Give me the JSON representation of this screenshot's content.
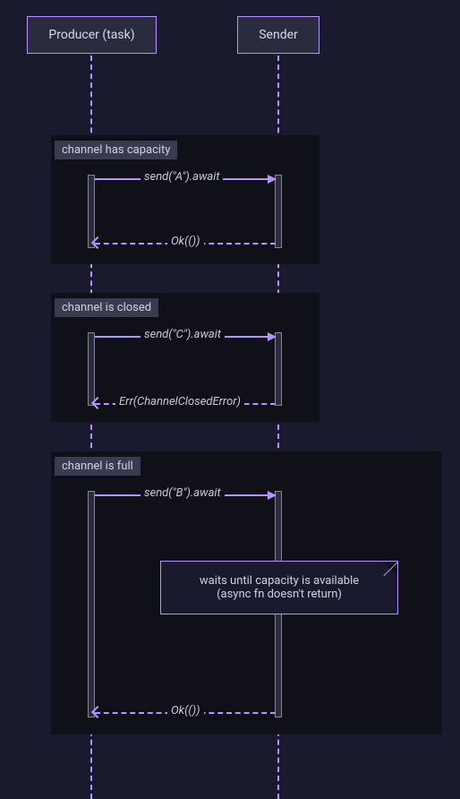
{
  "participants": {
    "producer": "Producer (task)",
    "sender": "Sender"
  },
  "boxes": [
    {
      "title": "channel has capacity"
    },
    {
      "title": "channel is closed"
    },
    {
      "title": "channel is full"
    }
  ],
  "messages": {
    "sendA": "send(\"A\").await",
    "okA": "Ok(())",
    "sendC": "send(\"C\").await",
    "errC": "Err(ChannelClosedError)",
    "sendB": "send(\"B\").await",
    "okB": "Ok(())"
  },
  "note": {
    "line1": "waits until capacity is available",
    "line2": "(async fn doesn't return)"
  },
  "layout": {
    "producerX": 102,
    "senderX": 311
  }
}
